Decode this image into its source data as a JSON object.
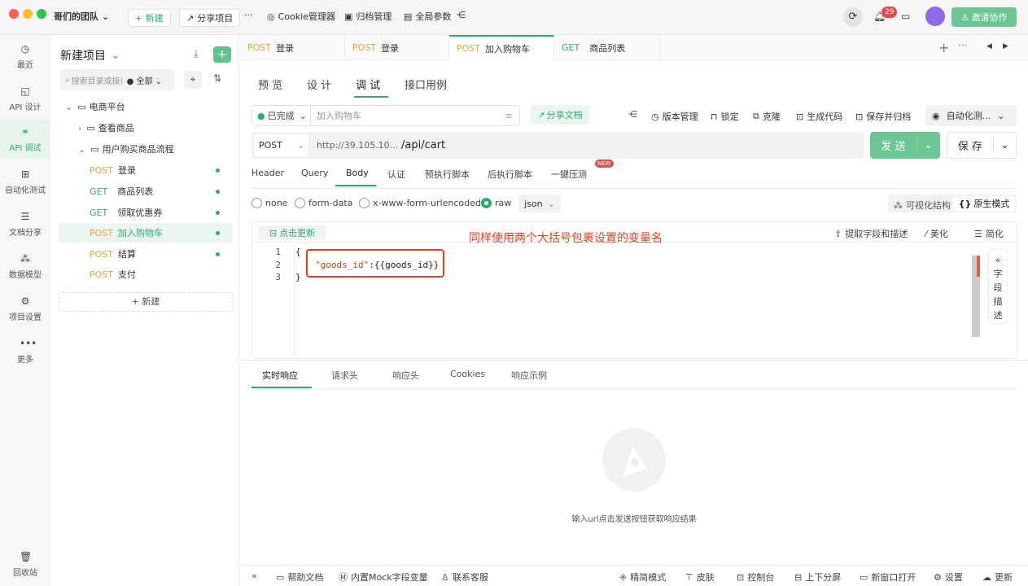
{
  "topbar": {
    "team": "哥们的团队",
    "new_label": "+ 新建",
    "share_project": "分享项目",
    "more": "···",
    "cookie_manager": "Cookie管理器",
    "archive": "归档管理",
    "global_params": "全局参数",
    "notification_count": "29",
    "invite": "邀请协作"
  },
  "leftnav": {
    "items": [
      {
        "label": "最近",
        "icon": "clock-icon"
      },
      {
        "label": "API 设计",
        "icon": "design-icon"
      },
      {
        "label": "API 调试",
        "icon": "link-icon"
      },
      {
        "label": "自动化测试",
        "icon": "flow-icon"
      },
      {
        "label": "文档分享",
        "icon": "doc-icon"
      },
      {
        "label": "数据模型",
        "icon": "model-icon"
      },
      {
        "label": "项目设置",
        "icon": "settings-icon"
      },
      {
        "label": "更多",
        "icon": "more-icon"
      }
    ],
    "trash": "回收站"
  },
  "tree": {
    "project": "新建项目",
    "search_placeholder": "搜索目录或接口",
    "filter": "全部",
    "nodes": [
      {
        "label": "电商平台"
      },
      {
        "label": "查看商品"
      },
      {
        "label": "用户购买商品流程"
      }
    ],
    "apis": [
      {
        "method": "POST",
        "name": "登录"
      },
      {
        "method": "GET",
        "name": "商品列表"
      },
      {
        "method": "GET",
        "name": "领取优惠券"
      },
      {
        "method": "POST",
        "name": "加入购物车"
      },
      {
        "method": "POST",
        "name": "结算"
      },
      {
        "method": "POST",
        "name": "支付"
      }
    ],
    "new_label": "+ 新建"
  },
  "tabs": [
    {
      "method": "POST",
      "name": "登录"
    },
    {
      "method": "POST",
      "name": "登录"
    },
    {
      "method": "POST",
      "name": "加入购物车"
    },
    {
      "method": "GET",
      "name": "商品列表"
    }
  ],
  "view_tabs": [
    "预 览",
    "设 计",
    "调 试",
    "接口用例"
  ],
  "toolbar": {
    "status": "已完成",
    "name_placeholder": "加入购物车",
    "share_doc": "分享文档",
    "version": "版本管理",
    "lock": "锁定",
    "clone": "克隆",
    "gen_code": "生成代码",
    "save_archive": "保存并归档",
    "auto": "自动化测..."
  },
  "request": {
    "method": "POST",
    "base_url": "http://39.105.10...",
    "path": "/api/cart",
    "send": "发 送",
    "save": "保 存"
  },
  "req_tabs": [
    "Header",
    "Query",
    "Body",
    "认证",
    "预执行脚本",
    "后执行脚本",
    "一键压测"
  ],
  "new_badge": "NEW",
  "body_types": [
    "none",
    "form-data",
    "x-www-form-urlencoded",
    "raw"
  ],
  "format": "json",
  "mode_visual": "可视化结构",
  "mode_raw": "原生模式",
  "editor": {
    "refresh": "点击更新",
    "annotation": "同样使用两个大括号包裹设置的变量名",
    "extract": "提取字段和描述",
    "beautify": "美化",
    "simplify": "简化",
    "line_numbers": [
      "1",
      "2",
      "3"
    ],
    "line1": "{",
    "line2_key": "\"goods_id\"",
    "line2_rest": ":{{goods_id}}",
    "line3": "}",
    "side_label": [
      "«",
      "字",
      "段",
      "描",
      "述"
    ]
  },
  "response": {
    "tabs": [
      "实时响应",
      "请求头",
      "响应头",
      "Cookies",
      "响应示例"
    ],
    "empty_hint": "输入url点击发送按钮获取响应结果"
  },
  "bottombar": {
    "help": "帮助文档",
    "mock": "内置Mock字段变量",
    "support": "联系客服",
    "compact": "精简模式",
    "skin": "皮肤",
    "console": "控制台",
    "split": "上下分屏",
    "new_window": "新窗口打开",
    "settings": "设置",
    "update": "更新"
  },
  "colors": {
    "accent": "#2eae6a",
    "post": "#f0a13a",
    "annotation": "#e8401c"
  }
}
